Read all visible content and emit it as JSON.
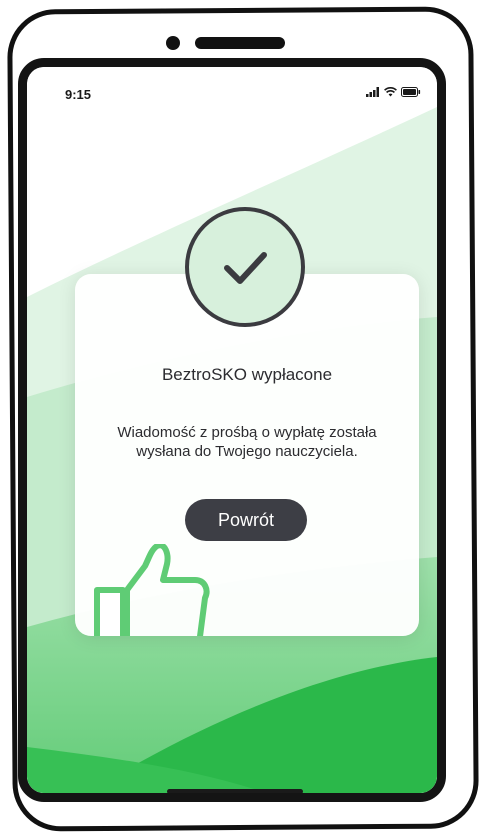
{
  "status_bar": {
    "time": "9:15",
    "icons": [
      "signal-icon",
      "wifi-icon",
      "battery-icon"
    ]
  },
  "dialog": {
    "title": "BeztroSKO wypłacone",
    "message_line1": "Wiadomość z prośbą o wypłatę została",
    "message_line2": "wysłana do Twojego nauczyciela.",
    "back_button_label": "Powrót",
    "icon": "checkmark-icon"
  },
  "colors": {
    "brand_green": "#2bb84a",
    "light_green": "#d7f0dc",
    "button_dark": "#3d3e45",
    "text_dark": "#2c2c30"
  }
}
